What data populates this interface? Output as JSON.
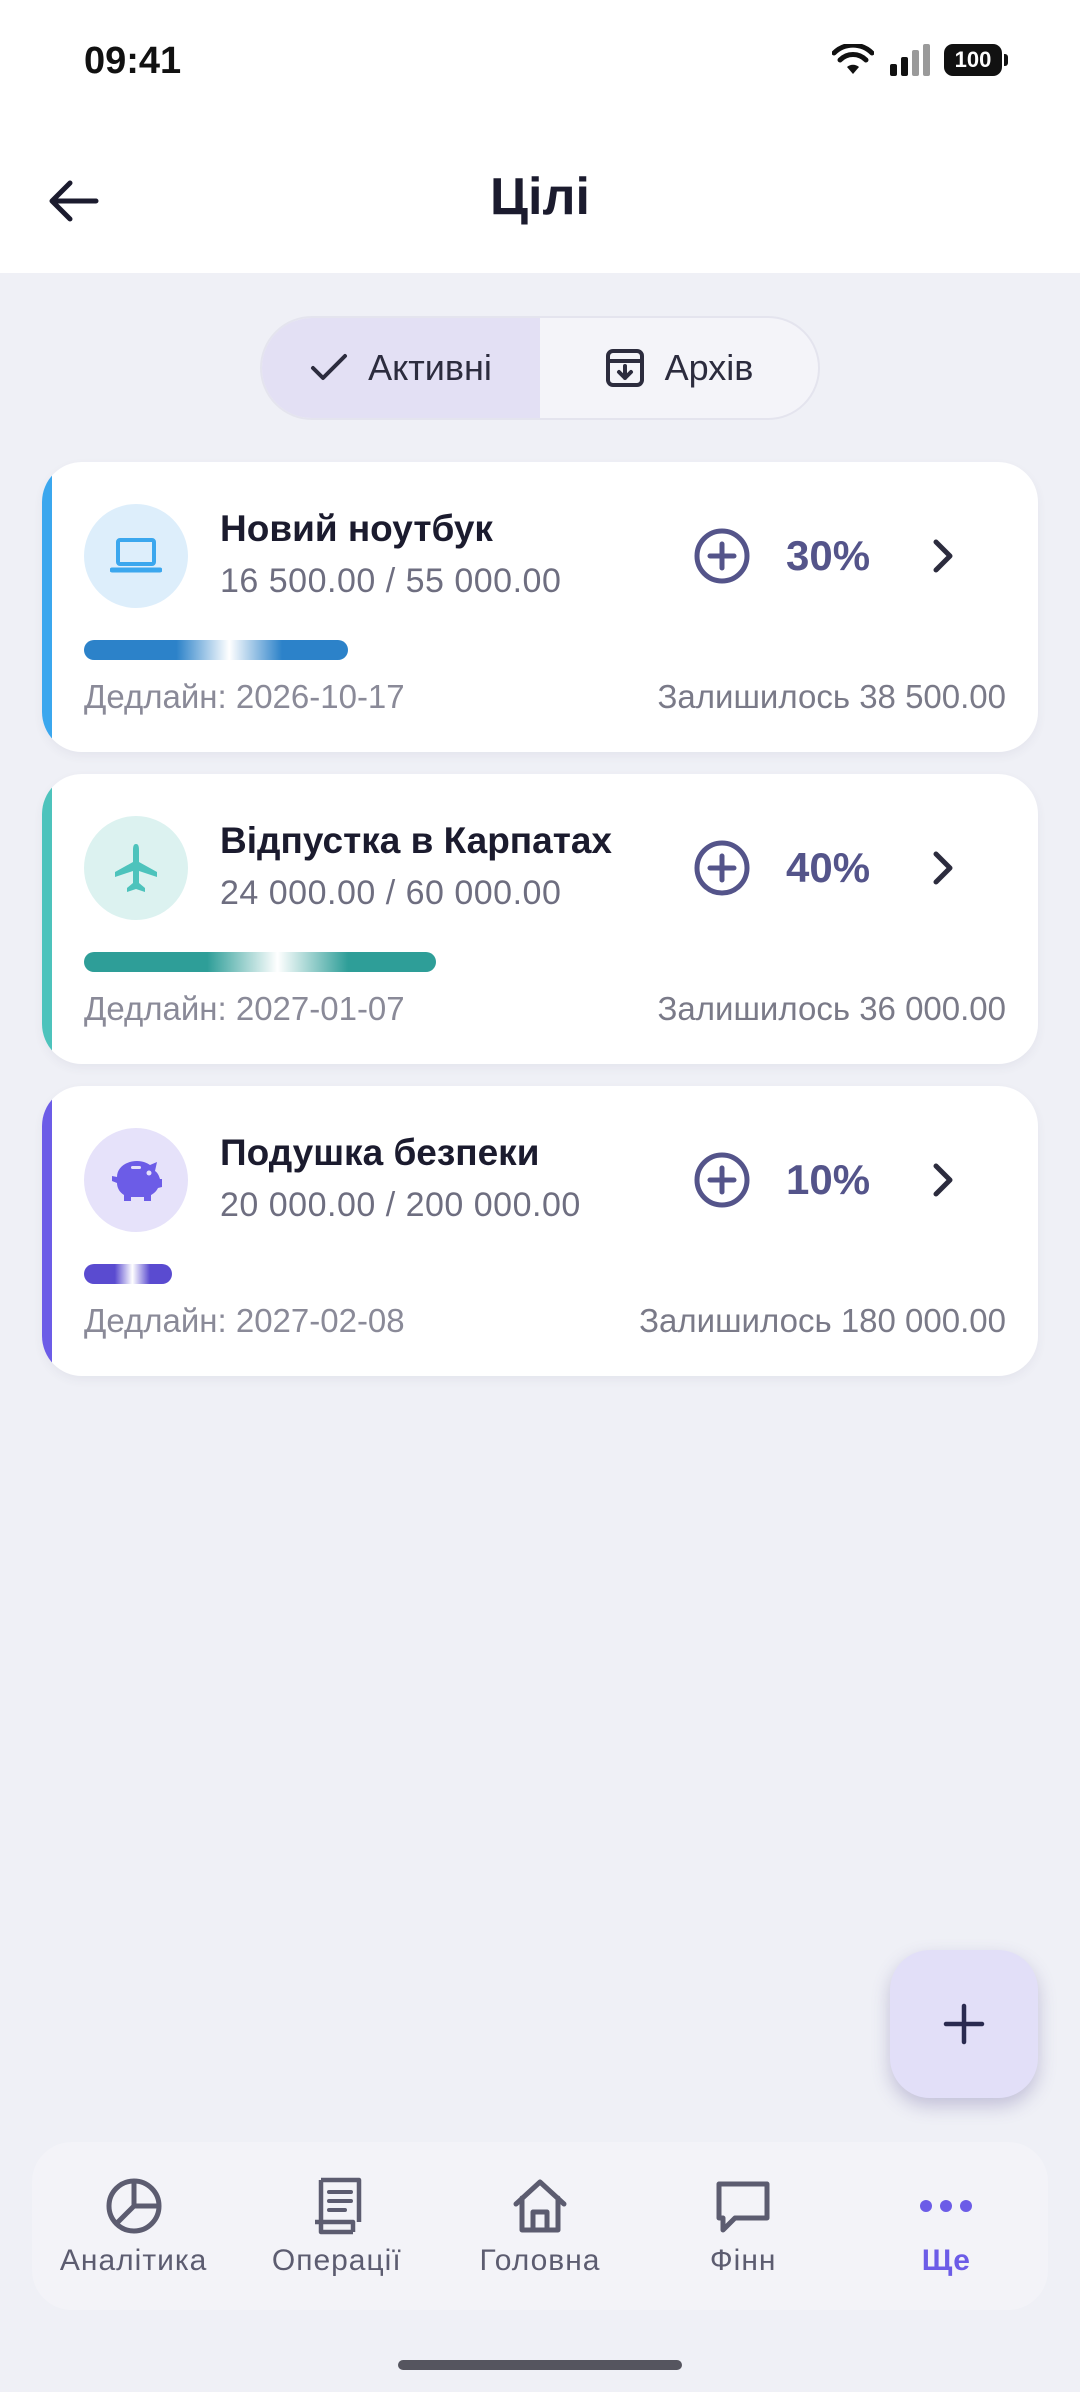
{
  "status_bar": {
    "time": "09:41",
    "battery": "100"
  },
  "header": {
    "title": "Цілі"
  },
  "tabs": [
    {
      "label": "Активні",
      "active": true
    },
    {
      "label": "Архів",
      "active": false
    }
  ],
  "goals": [
    {
      "name": "Новий ноутбук",
      "amount": "16 500.00 / 55 000.00",
      "percent": "30%",
      "progress": 0.3,
      "deadline": "Дедлайн: 2026-10-17",
      "remaining": "Залишилось 38 500.00",
      "icon": "laptop-icon",
      "accent": "#3BA7EE",
      "icon_bg": "#DDEEFB",
      "bar_color": "#2C82C9"
    },
    {
      "name": "Відпустка в Карпатах",
      "amount": "24 000.00 / 60 000.00",
      "percent": "40%",
      "progress": 0.4,
      "deadline": "Дедлайн: 2027-01-07",
      "remaining": "Залишилось 36 000.00",
      "icon": "airplane-icon",
      "accent": "#4DC3BC",
      "icon_bg": "#DCF2F0",
      "bar_color": "#2E9E98"
    },
    {
      "name": "Подушка безпеки",
      "amount": "20 000.00 / 200 000.00",
      "percent": "10%",
      "progress": 0.1,
      "deadline": "Дедлайн: 2027-02-08",
      "remaining": "Залишилось 180 000.00",
      "icon": "piggy-bank-icon",
      "accent": "#6C5CE7",
      "icon_bg": "#E6E2FA",
      "bar_color": "#5A4BD0"
    }
  ],
  "fab": {
    "icon": "plus-icon"
  },
  "nav": [
    {
      "label": "Аналітика",
      "icon": "pie-chart-icon",
      "active": false
    },
    {
      "label": "Операції",
      "icon": "receipt-icon",
      "active": false
    },
    {
      "label": "Головна",
      "icon": "home-icon",
      "active": false
    },
    {
      "label": "Фінн",
      "icon": "chat-icon",
      "active": false
    },
    {
      "label": "Ще",
      "icon": "more-dots-icon",
      "active": true
    }
  ]
}
